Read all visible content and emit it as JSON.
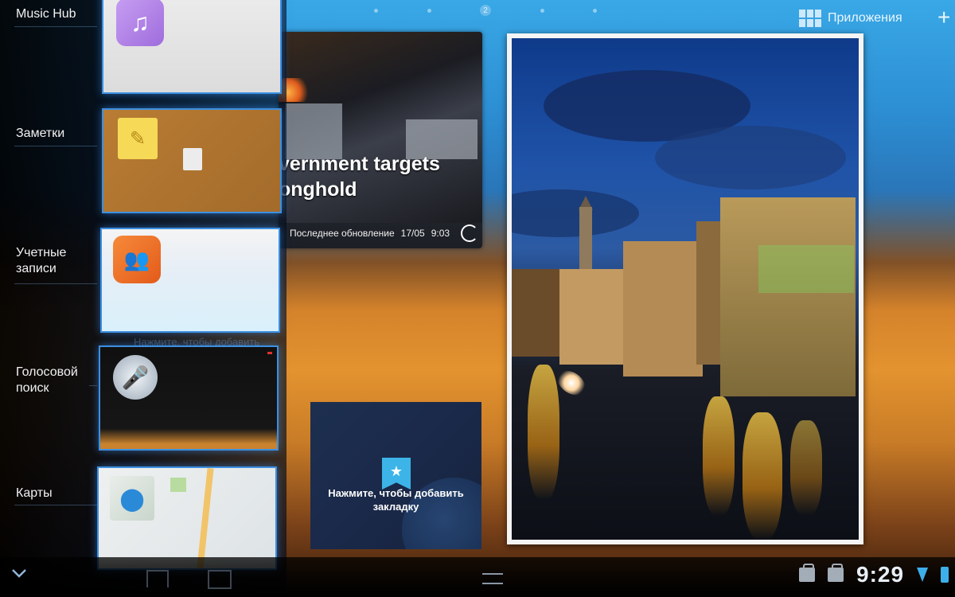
{
  "home": {
    "page_indicator": "2",
    "apps_button_label": "Приложения",
    "add_button_label": "+"
  },
  "news_widget": {
    "headline": "vernment targets\nonghold",
    "last_update_label": "Последнее обновление",
    "last_update_date": "17/05",
    "last_update_time": "9:03"
  },
  "bookmark_widget": {
    "prompt": "Нажмите, чтобы добавить закладку"
  },
  "recent_apps": {
    "items": [
      {
        "label": "Music Hub",
        "icon": "music-note-icon"
      },
      {
        "label": "Заметки",
        "icon": "sticky-note-icon"
      },
      {
        "label": "Учетные записи",
        "icon": "accounts-icon"
      },
      {
        "label": "Голосовой поиск",
        "icon": "microphone-icon"
      },
      {
        "label": "Карты",
        "icon": "maps-icon"
      }
    ],
    "faded_hint": "Нажмите, чтобы добавить"
  },
  "status_bar": {
    "time": "9:29"
  },
  "colors": {
    "highlight_blue": "#3c8fe0",
    "wifi_blue": "#3eaee8"
  }
}
